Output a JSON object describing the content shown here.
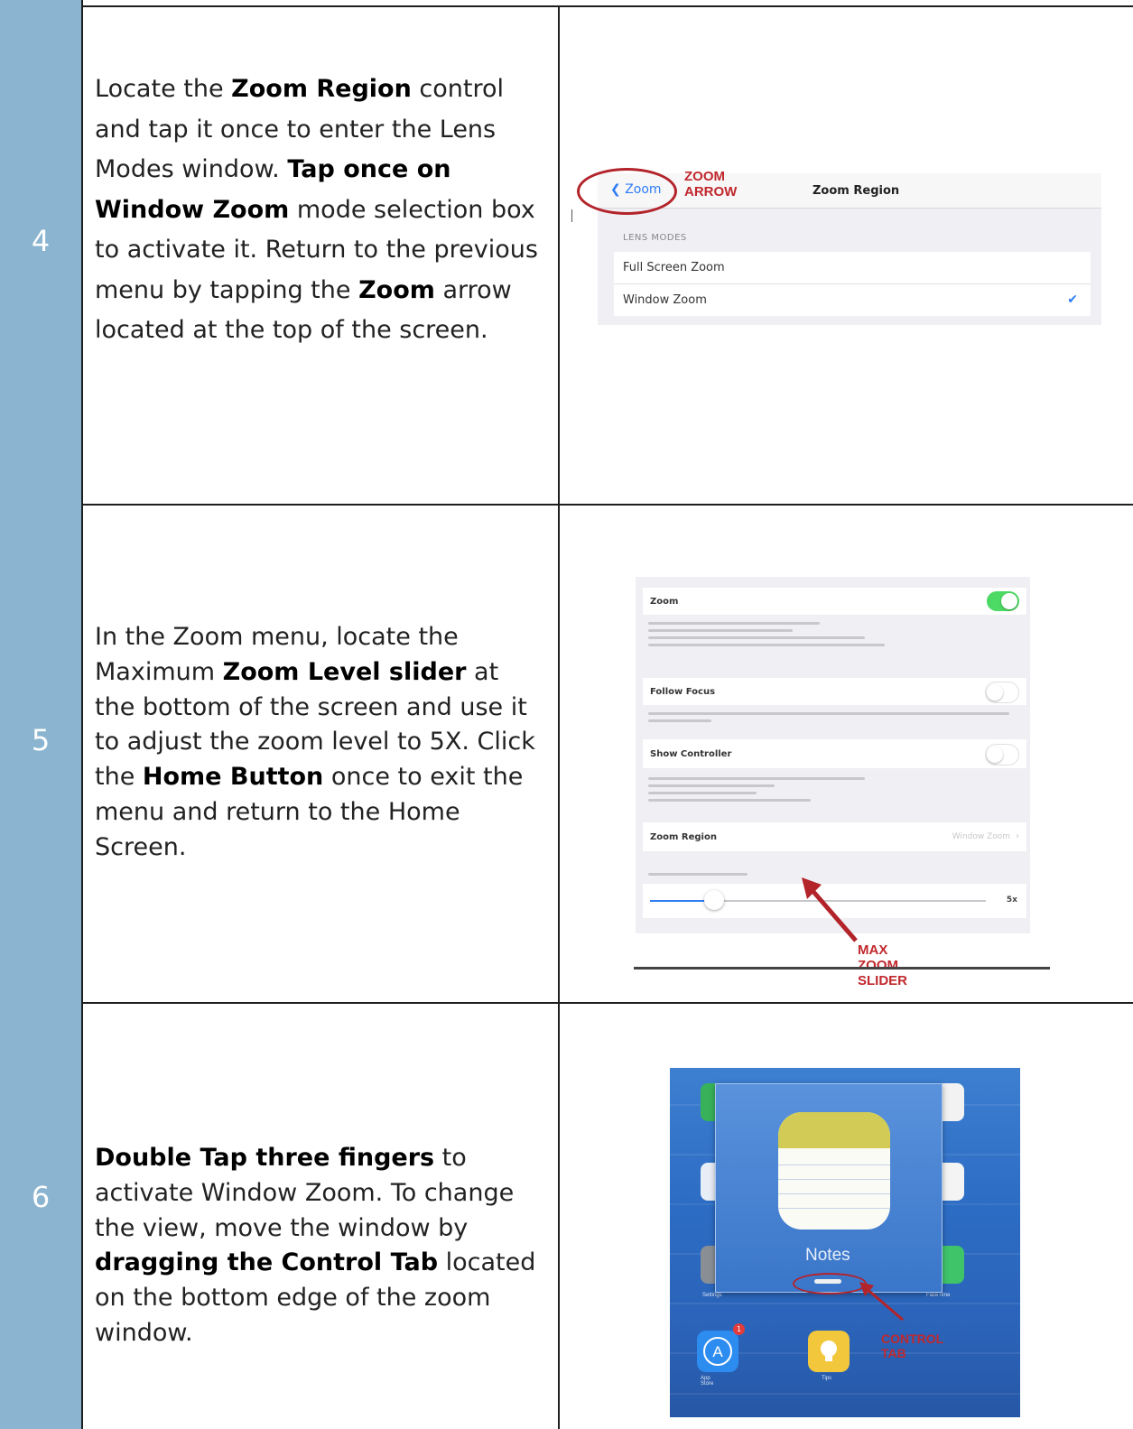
{
  "rows": [
    {
      "number": "4",
      "text": [
        {
          "t": "Locate the ",
          "b": false
        },
        {
          "t": "Zoom Region",
          "b": true
        },
        {
          "t": " control and tap it once to enter the Lens Modes window. ",
          "b": false
        },
        {
          "t": "Tap once on Window Zoom",
          "b": true
        },
        {
          "t": " mode selection box to activate it. Return to the previous menu by tapping the ",
          "b": false
        },
        {
          "t": "Zoom",
          "b": true
        },
        {
          "t": " arrow located at the top of the screen.",
          "b": false
        }
      ]
    },
    {
      "number": "5",
      "text": [
        {
          "t": "In the Zoom menu, locate the Maximum ",
          "b": false
        },
        {
          "t": "Zoom Level slider",
          "b": true
        },
        {
          "t": " at the bottom of the screen and use it to adjust the zoom level to 5X. Click the ",
          "b": false
        },
        {
          "t": "Home Button",
          "b": true
        },
        {
          "t": " once to exit the menu and return to the Home Screen.",
          "b": false
        }
      ]
    },
    {
      "number": "6",
      "text": [
        {
          "t": "Double Tap three fingers",
          "b": true
        },
        {
          "t": " to activate Window Zoom. To change the view, move the window by ",
          "b": false
        },
        {
          "t": "dragging the Control Tab",
          "b": true
        },
        {
          "t": " located on the bottom edge of the zoom window.",
          "b": false
        }
      ]
    }
  ],
  "shot4": {
    "back_label": "Zoom",
    "nav_title": "Zoom Region",
    "annotation": "ZOOM ARROW",
    "section_header": "LENS MODES",
    "items": [
      "Full Screen Zoom",
      "Window Zoom"
    ],
    "check": "✔"
  },
  "shot5": {
    "zoom_label": "Zoom",
    "follow_focus_label": "Follow Focus",
    "show_controller_label": "Show Controller",
    "zoom_region_label": "Zoom Region",
    "zoom_region_value": "Window Zoom",
    "slider_value_label": "5x",
    "slider_level": 0.19,
    "annotation": "MAX ZOOM SLIDER"
  },
  "shot6": {
    "app_label": "Notes",
    "annotation": "CONTROL TAB",
    "settings_label": "Settings",
    "facetime_label": "FaceTime",
    "appstore_label": "App Store",
    "tips_label": "Tips",
    "badge": "1"
  },
  "colors": {
    "number_column": "#8ab4cf",
    "annotation_red": "#c0282d",
    "ios_blue": "#2f7cf6",
    "toggle_green": "#4cd964"
  }
}
